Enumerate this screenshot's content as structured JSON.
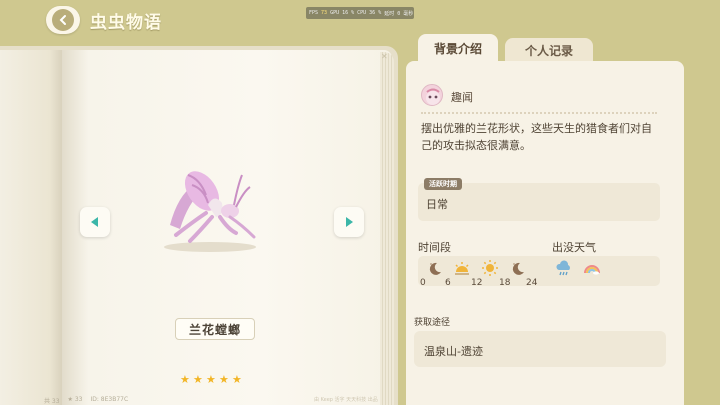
{
  "header": {
    "title": "虫虫物语",
    "perf": [
      "FPS",
      "73",
      "GPU",
      "16 %",
      "CPU",
      "36 %",
      "延时",
      "0 毫秒"
    ]
  },
  "book": {
    "creature_name": "兰花螳螂",
    "rating": 5,
    "rating_max": 5,
    "footer": [
      "共 33",
      "★ 33",
      "ID: 8E3B77C"
    ],
    "footer_right": "由 Keep 活字 天天科技 出品"
  },
  "tabs": [
    {
      "label": "背景介绍",
      "active": true
    },
    {
      "label": "个人记录",
      "active": false
    }
  ],
  "info": {
    "author": "趣闻",
    "description": "摆出优雅的兰花形状，这些天生的猎食者们对自己的攻击拟态很满意。",
    "active_badge": "活跃时期",
    "active_value": "日常",
    "time_label": "时间段",
    "weather_label": "出没天气",
    "time_ticks": [
      "0",
      "6",
      "12",
      "18",
      "24"
    ],
    "time_icons": [
      "moon-icon",
      "sunrise-icon",
      "sun-icon",
      "moon-icon"
    ],
    "weather_icons": [
      "rain-icon",
      "rainbow-icon"
    ],
    "obtain_label": "获取途径",
    "obtain_value": "温泉山-遗迹"
  },
  "colors": {
    "background": "#cfc88f",
    "panel": "#f7f2e6",
    "accent_teal": "#3bb6a8",
    "star": "#f2b526"
  }
}
